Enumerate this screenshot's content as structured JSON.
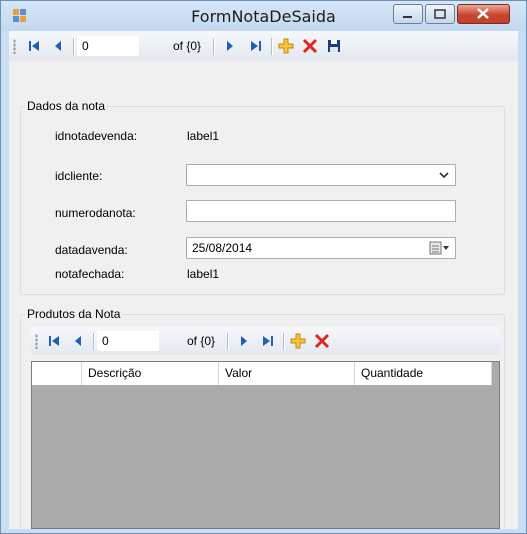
{
  "window": {
    "title": "FormNotaDeSaida"
  },
  "top_navigator": {
    "position": "0",
    "count": "of {0}"
  },
  "dados_nota": {
    "legend": "Dados da nota",
    "idnotadevenda_label": "idnotadevenda:",
    "idnotadevenda_value": "label1",
    "idcliente_label": "idcliente:",
    "idcliente_value": "",
    "numerodanota_label": "numerodanota:",
    "numerodanota_value": "",
    "datadavenda_label": "datadavenda:",
    "datadavenda_value": "25/08/2014",
    "notafechada_label": "notafechada:",
    "notafechada_value": "label1"
  },
  "produtos": {
    "legend": "Produtos da Nota",
    "navigator": {
      "position": "0",
      "count": "of {0}"
    },
    "columns": [
      "Descrição",
      "Valor",
      "Quantidade"
    ]
  },
  "colors": {
    "nav_blue": "#1f5fb8",
    "delete_red": "#e0261b",
    "add_gold": "#e6a100",
    "grid_bg": "#ababab"
  },
  "icons": [
    "app-icon",
    "move-first-icon",
    "move-previous-icon",
    "move-next-icon",
    "move-last-icon",
    "add-new-icon",
    "delete-icon",
    "save-icon",
    "dropdown-arrow-icon",
    "calendar-icon"
  ]
}
